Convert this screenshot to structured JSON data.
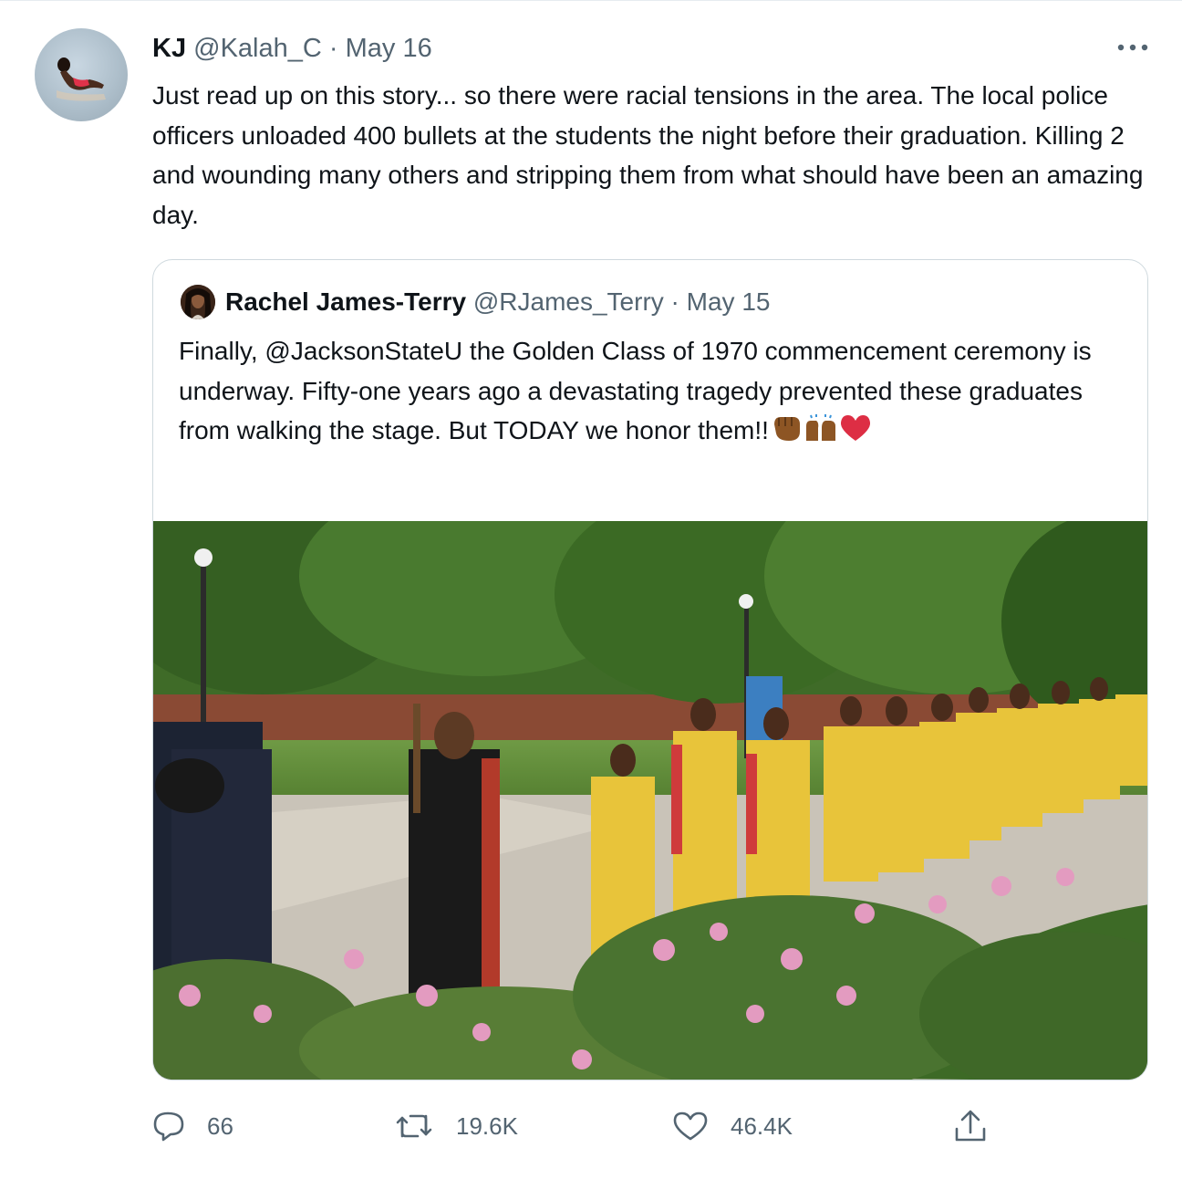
{
  "tweet": {
    "author_name": "KJ",
    "author_handle": "@Kalah_C",
    "separator": "·",
    "date": "May 16",
    "text": "Just read up on this story... so there were racial tensions in the area. The local police officers unloaded 400 bullets at the students the night before their graduation. Killing 2 and wounding many others and stripping them from what should have been an amazing day."
  },
  "quoted_tweet": {
    "author_name": "Rachel James-Terry",
    "author_handle": "@RJames_Terry",
    "separator": "·",
    "date": "May 15",
    "text": "Finally, @JacksonStateU the Golden Class of 1970 commencement ceremony is underway. Fifty-one years ago a devastating tragedy prevented these graduates from walking the stage. But TODAY we honor them!!",
    "emojis": [
      "raised-fist-emoji",
      "raising-hands-emoji",
      "red-heart-emoji"
    ]
  },
  "actions": {
    "reply_count": "66",
    "retweet_count": "19.6K",
    "like_count": "46.4K"
  },
  "icons": [
    "more-icon",
    "reply-icon",
    "retweet-icon",
    "like-icon",
    "share-icon"
  ],
  "colors": {
    "text_primary": "#0f1419",
    "text_secondary": "#536471",
    "border": "#cfd9de"
  }
}
